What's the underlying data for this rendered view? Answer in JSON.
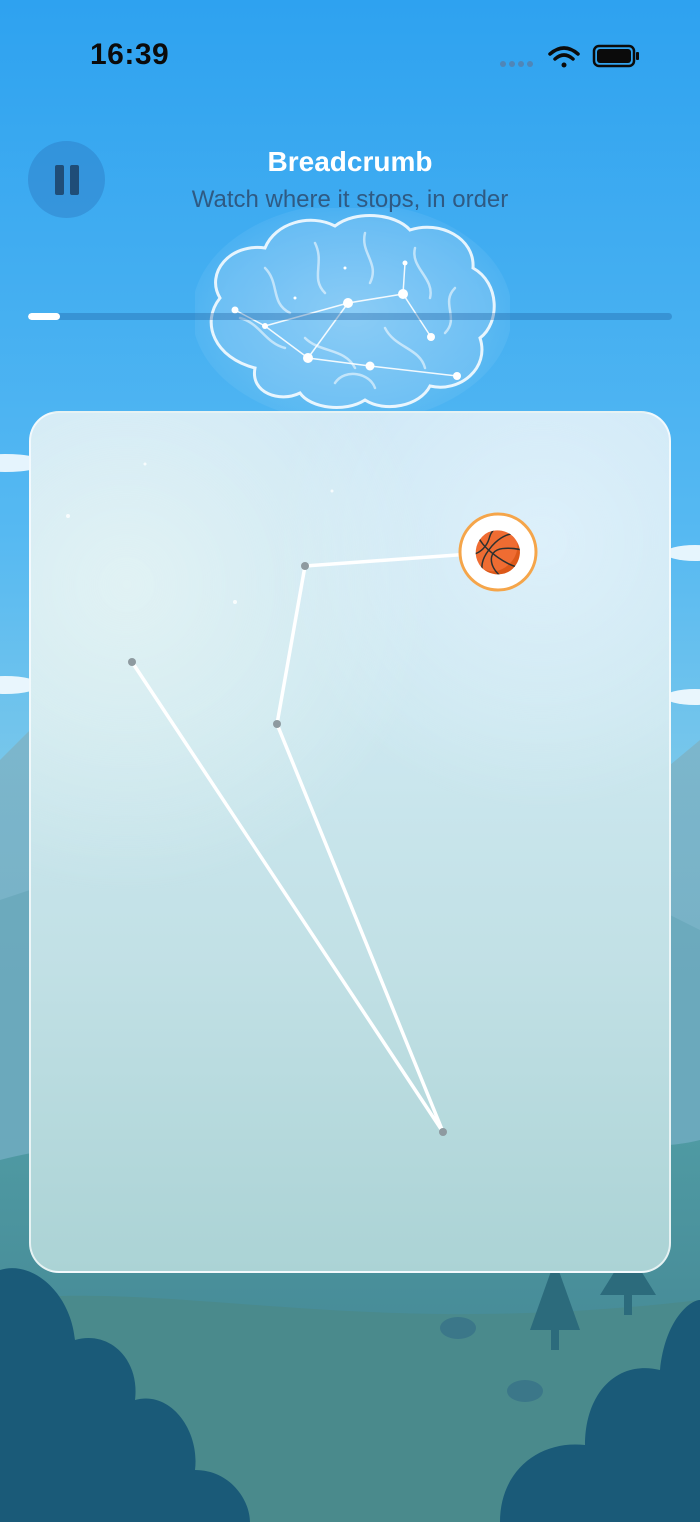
{
  "status_bar": {
    "time": "16:39",
    "icons": [
      "signal-dots-icon",
      "wifi-icon",
      "battery-icon"
    ]
  },
  "header": {
    "pause_icon": "pause-icon",
    "title": "Breadcrumb",
    "subtitle": "Watch where it stops, in order"
  },
  "progress": {
    "value": 0.05
  },
  "board": {
    "current_item": "🏀",
    "current_item_name": "basketball",
    "ring_color": "#f5a54a",
    "path_color": "#ffffff",
    "waypoint_color": "#8e9aa0"
  },
  "colors": {
    "sky_top": "#2ea2f0",
    "sky_mid": "#56b9f2",
    "hill_dark": "#1a5a78"
  }
}
